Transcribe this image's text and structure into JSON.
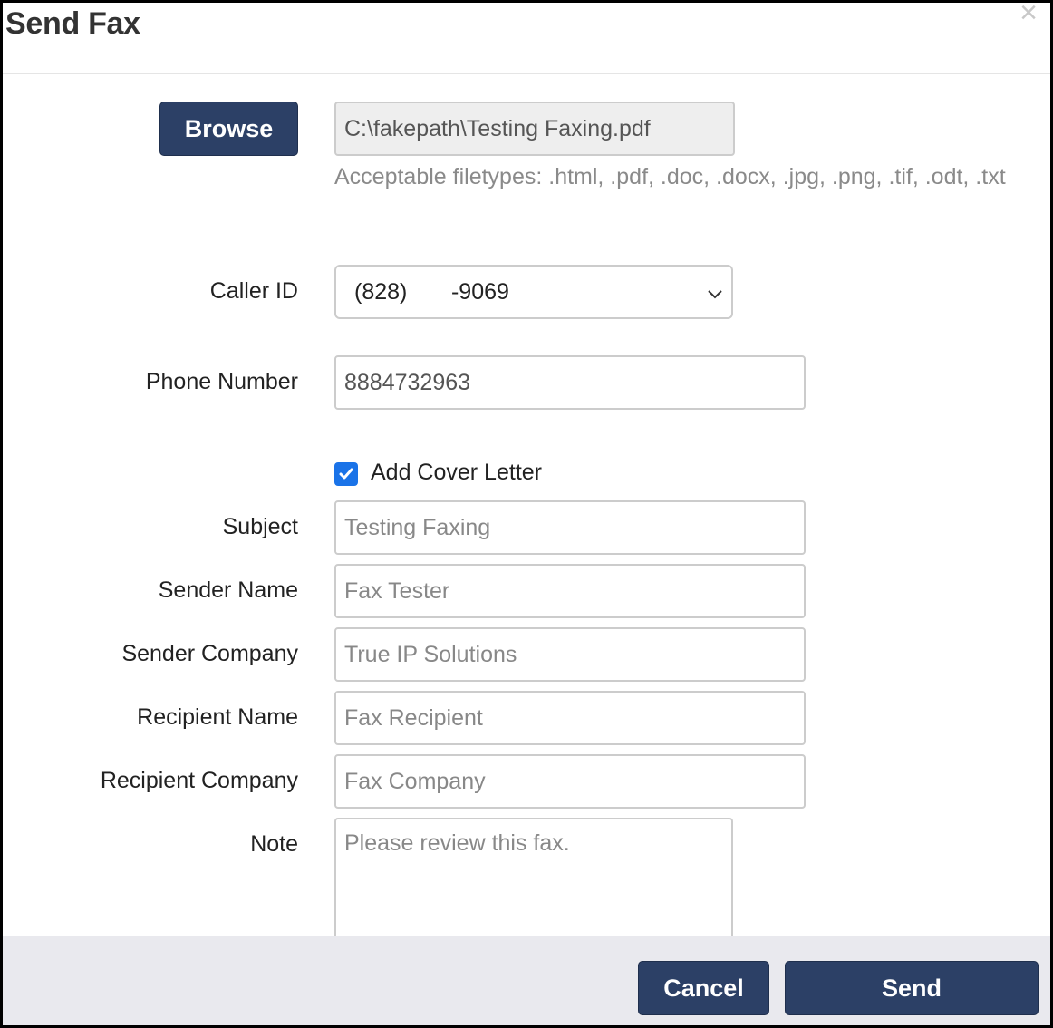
{
  "dialog": {
    "title": "Send Fax",
    "close_glyph": "×"
  },
  "file": {
    "browse_label": "Browse",
    "path_value": "C:\\fakepath\\Testing Faxing.pdf",
    "help_text": "Acceptable filetypes: .html, .pdf, .doc, .docx, .jpg, .png, .tif, .odt, .txt"
  },
  "caller_id": {
    "label": "Caller ID",
    "selected": "(828)       -9069",
    "icon": "chevron-down-icon"
  },
  "phone": {
    "label": "Phone Number",
    "value": "8884732963"
  },
  "cover": {
    "checkbox_label": "Add Cover Letter",
    "checked": true,
    "subject": {
      "label": "Subject",
      "placeholder": "Testing Faxing"
    },
    "sender_name": {
      "label": "Sender Name",
      "placeholder": "Fax Tester"
    },
    "sender_company": {
      "label": "Sender Company",
      "placeholder": "True IP Solutions"
    },
    "recipient_name": {
      "label": "Recipient Name",
      "placeholder": "Fax Recipient"
    },
    "recipient_company": {
      "label": "Recipient Company",
      "placeholder": "Fax Company"
    },
    "note": {
      "label": "Note",
      "placeholder": "Please review this fax."
    }
  },
  "footer": {
    "cancel_label": "Cancel",
    "send_label": "Send"
  },
  "colors": {
    "primary_button": "#2c4066",
    "checkbox": "#1a73e8",
    "footer_bg": "#e9e9ee"
  }
}
